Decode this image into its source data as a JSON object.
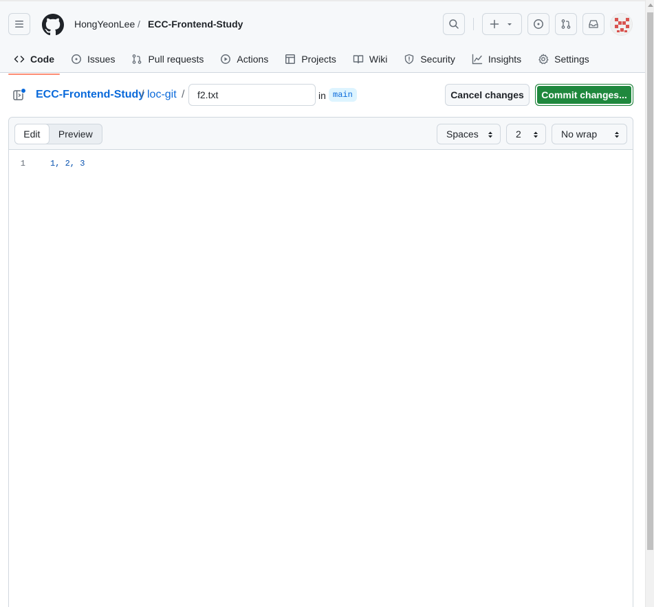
{
  "header": {
    "owner": "HongYeonLee",
    "separator": "/",
    "repo": "ECC-Frontend-Study"
  },
  "nav": {
    "tabs": [
      {
        "label": "Code",
        "icon": "code-icon",
        "active": true
      },
      {
        "label": "Issues",
        "icon": "issue-icon"
      },
      {
        "label": "Pull requests",
        "icon": "pull-request-icon"
      },
      {
        "label": "Actions",
        "icon": "play-icon"
      },
      {
        "label": "Projects",
        "icon": "table-icon"
      },
      {
        "label": "Wiki",
        "icon": "book-icon"
      },
      {
        "label": "Security",
        "icon": "shield-icon"
      },
      {
        "label": "Insights",
        "icon": "graph-icon"
      },
      {
        "label": "Settings",
        "icon": "gear-icon"
      }
    ]
  },
  "path": {
    "repo": "ECC-Frontend-Study",
    "sep": "/",
    "directory": "loc-git",
    "filename": "f2.txt",
    "in_label": "in",
    "branch": "main"
  },
  "actions": {
    "cancel": "Cancel changes",
    "commit": "Commit changes..."
  },
  "editor": {
    "mode_edit": "Edit",
    "mode_preview": "Preview",
    "indent_mode": "Spaces",
    "indent_size": "2",
    "wrap_mode": "No wrap",
    "lines": [
      {
        "number": "1",
        "text": "1, 2, 3"
      }
    ]
  },
  "colors": {
    "accent_link": "#0969da",
    "commit_green": "#1f883d",
    "active_tab_underline": "#fd8c73"
  }
}
